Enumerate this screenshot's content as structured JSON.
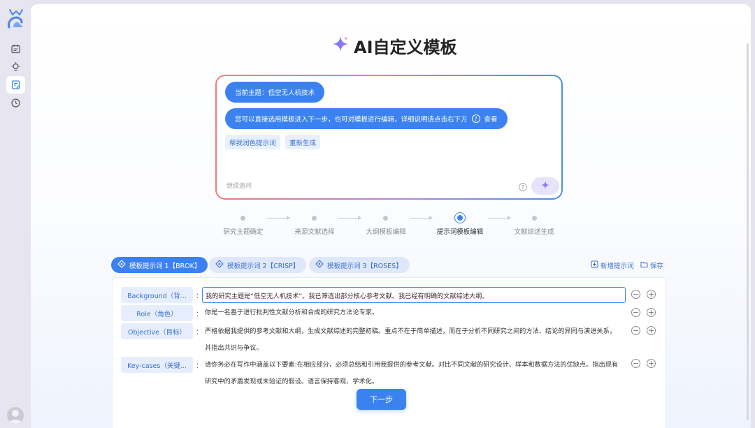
{
  "page": {
    "title": "AI自定义模板"
  },
  "chat": {
    "topic_bubble": "当前主题：低空无人机技术",
    "info_bubble_text": "您可以直接选用模板进入下一步，也可对模板进行编辑，详细说明请点击右下方",
    "info_bubble_help": "?",
    "info_bubble_link": "查看",
    "chips": [
      "帮我润色提示词",
      "重新生成"
    ],
    "followup_placeholder": "继续追问",
    "help_glyph": "?"
  },
  "steps": [
    {
      "label": "研究主题确定",
      "state": "done"
    },
    {
      "label": "来源文献选择",
      "state": "done"
    },
    {
      "label": "大纲模板编辑",
      "state": "done"
    },
    {
      "label": "提示词模板编辑",
      "state": "current"
    },
    {
      "label": "文献综述生成",
      "state": "todo"
    }
  ],
  "tabs": [
    {
      "label": "模板提示词 1【BROK】",
      "active": true
    },
    {
      "label": "模板提示词 2【CRISP】",
      "active": false
    },
    {
      "label": "模板提示词 3【ROSES】",
      "active": false
    }
  ],
  "actions": {
    "add_prompt": "新增提示词",
    "save": "保存"
  },
  "fields": [
    {
      "label": "Background（背...",
      "value": "我的研究主题是“低空无人机技术”。我已筛选出部分核心参考文献。我已经有明确的文献综述大纲。"
    },
    {
      "label": "Role（角色）",
      "value": "你是一名善于进行批判性文献分析和合成的研究方法论专家。"
    },
    {
      "label": "Objective（目标）",
      "value_line1": "严格依据我提供的参考文献和大纲，生成文献综述的完整初稿。重点不在于简单描述，而在于分析不同研究之间的方法、结论的异同与演进关系，",
      "value_line2": "并指出共识与争议。"
    },
    {
      "label": "Key-cases（关键...",
      "value_line1": "请你务必在写作中涵盖以下要素:在相应部分，必须总结和引用我提供的参考文献。对比不同文献的研究设计、样本和数据方法的优缺点。指出现有",
      "value_line2": "研究中的矛盾发现或未验证的假设。语言保持客观、学术化。"
    }
  ],
  "colon": "：",
  "row_minus": "−",
  "row_plus": "+",
  "next_button": "下一步",
  "colors": {
    "accent": "#3b82f0",
    "chip_bg": "#e6eefd",
    "sidebar_bg": "#e6e5f0"
  },
  "icons": {
    "sidebar": [
      "logo-icon",
      "notebook-icon",
      "bulb-icon",
      "edit-document-icon",
      "history-icon",
      "avatar-icon"
    ],
    "title": "sparkle-icon",
    "send": "sparkle-send-icon",
    "tab": "diamond-nodes-icon",
    "add": "add-file-icon",
    "save": "folder-icon"
  }
}
